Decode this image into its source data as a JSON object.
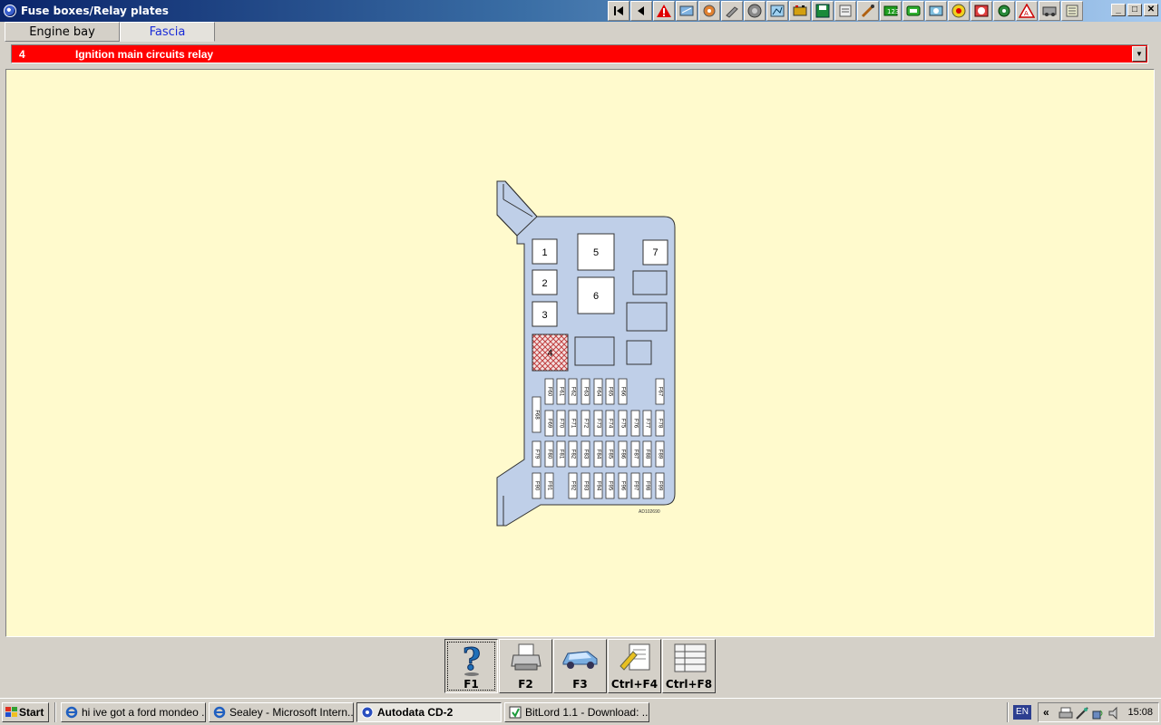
{
  "window": {
    "title": "Fuse boxes/Relay plates",
    "controls": [
      "_",
      "□",
      "✕"
    ]
  },
  "toolbar": {
    "icons": [
      "first-icon",
      "prev-icon",
      "warning-icon",
      "car-info-icon",
      "engine-icon",
      "tools-icon",
      "wheel-icon",
      "diagram-icon",
      "battery-icon",
      "save-icon",
      "print-page-icon",
      "probe-icon",
      "timing-icon",
      "repair-icon",
      "sensor-icon",
      "tyre-icon",
      "abs-icon",
      "brake-icon",
      "belt-icon",
      "airbag-icon",
      "aircon-icon",
      "service-icon"
    ]
  },
  "tabs": [
    {
      "label": "Engine bay",
      "active": false
    },
    {
      "label": "Fascia",
      "active": true
    }
  ],
  "selector": {
    "number": "4",
    "description": "Ignition main circuits relay",
    "background": "#ff0000"
  },
  "diagram": {
    "relays": [
      "1",
      "2",
      "3",
      "4",
      "5",
      "6",
      "7"
    ],
    "selected_relay": "4",
    "fuse_rows": [
      [
        "F60",
        "F61",
        "F62",
        "F63",
        "F64",
        "F65",
        "F66",
        "F67"
      ],
      [
        "F68",
        "F69",
        "F70",
        "F71",
        "F72",
        "F73",
        "F74",
        "F75",
        "F76",
        "F77",
        "F78"
      ],
      [
        "F79",
        "F80",
        "F81",
        "F82",
        "F83",
        "F84",
        "F85",
        "F86",
        "F87",
        "F88",
        "F89"
      ],
      [
        "F90",
        "F91",
        "F92",
        "F93",
        "F94",
        "F95",
        "F96",
        "F97",
        "F98",
        "F99"
      ]
    ],
    "reference": "AD102690",
    "plate_color": "#bfcfe8",
    "background": "#fffacd"
  },
  "function_keys": [
    {
      "label": "F1",
      "icon": "help-icon",
      "pressed": true
    },
    {
      "label": "F2",
      "icon": "printer-icon",
      "pressed": false
    },
    {
      "label": "F3",
      "icon": "car-icon",
      "pressed": false
    },
    {
      "label": "Ctrl+F4",
      "icon": "notes-icon",
      "pressed": false
    },
    {
      "label": "Ctrl+F8",
      "icon": "list-icon",
      "pressed": false
    }
  ],
  "taskbar": {
    "start_label": "Start",
    "tasks": [
      {
        "label": "hi ive got a ford mondeo ...",
        "icon": "ie-icon",
        "active": false
      },
      {
        "label": "Sealey - Microsoft Intern...",
        "icon": "ie-icon",
        "active": false
      },
      {
        "label": "Autodata CD-2",
        "icon": "autodata-icon",
        "active": true
      },
      {
        "label": "BitLord 1.1 - Download: ...",
        "icon": "bitlord-icon",
        "active": false
      }
    ],
    "language": "EN",
    "tray_chevron": "«",
    "clock": "15:08"
  }
}
